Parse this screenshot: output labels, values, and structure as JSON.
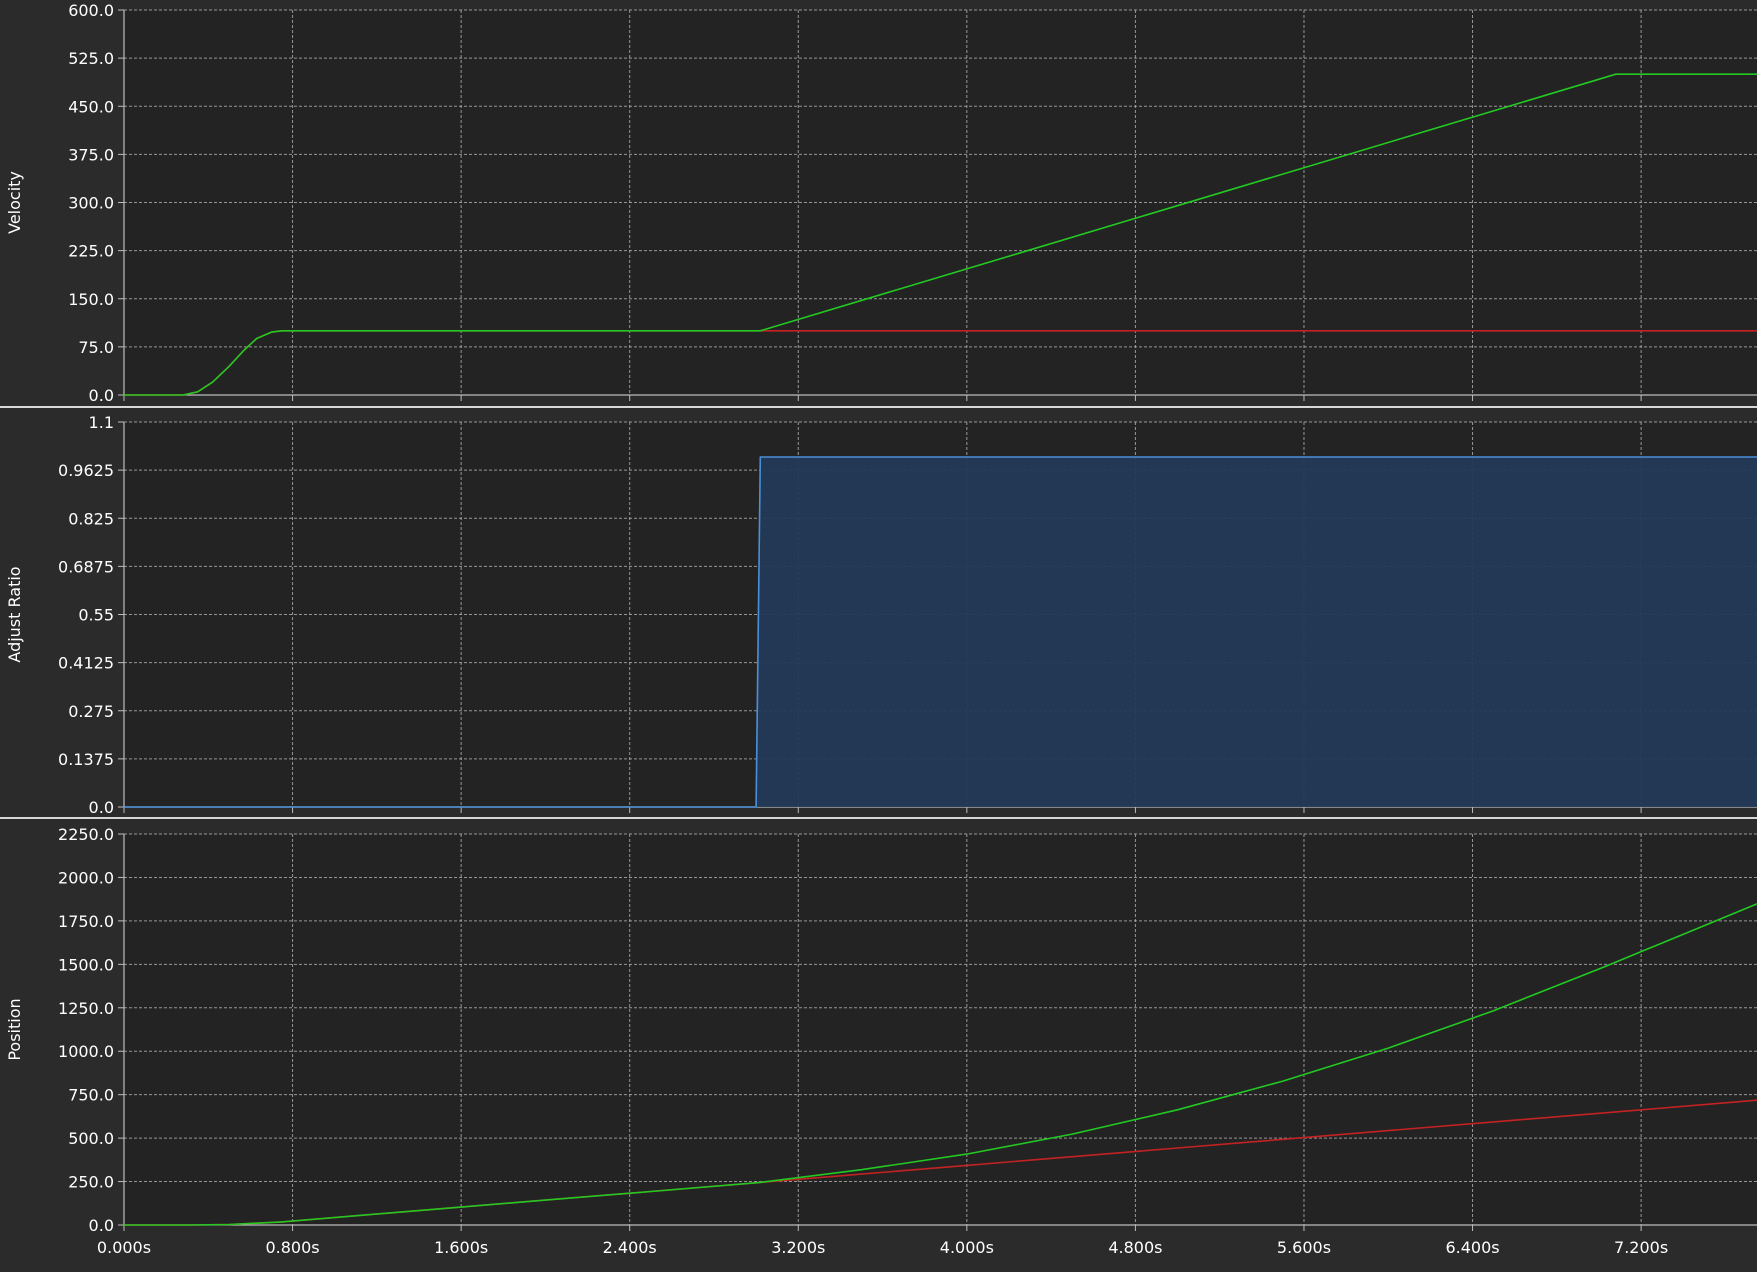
{
  "colors": {
    "background": "#2b2b2b",
    "plot_background": "#232323",
    "grid": "#bdbdbd",
    "text": "#ffffff",
    "separator": "#d8d8d8",
    "green": "#22c922",
    "red": "#c42222",
    "blue": "#4a90d9",
    "blue_fill": "#243a57"
  },
  "chart_data": [
    {
      "type": "line",
      "ylabel": "Velocity",
      "xlim": [
        0,
        7.75
      ],
      "ylim": [
        0,
        600
      ],
      "yticks": [
        "0.0",
        "75.0",
        "150.0",
        "225.0",
        "300.0",
        "375.0",
        "450.0",
        "525.0",
        "600.0"
      ],
      "xticks": [
        "0.000s",
        "0.800s",
        "1.600s",
        "2.400s",
        "3.200s",
        "4.000s",
        "4.800s",
        "5.600s",
        "6.400s",
        "7.200s"
      ],
      "show_xtick_labels": false,
      "grid": true,
      "series": [
        {
          "color_key": "red",
          "points": [
            [
              0,
              0
            ],
            [
              0.2,
              0
            ],
            [
              0.28,
              0
            ],
            [
              0.35,
              5
            ],
            [
              0.42,
              20
            ],
            [
              0.5,
              45
            ],
            [
              0.57,
              70
            ],
            [
              0.63,
              88
            ],
            [
              0.7,
              98
            ],
            [
              0.75,
              100
            ],
            [
              7.75,
              100
            ]
          ]
        },
        {
          "color_key": "green",
          "points": [
            [
              0,
              0
            ],
            [
              0.2,
              0
            ],
            [
              0.28,
              0
            ],
            [
              0.35,
              5
            ],
            [
              0.42,
              20
            ],
            [
              0.5,
              45
            ],
            [
              0.57,
              70
            ],
            [
              0.63,
              88
            ],
            [
              0.7,
              98
            ],
            [
              0.75,
              100
            ],
            [
              3.02,
              100
            ],
            [
              7.08,
              500
            ],
            [
              7.75,
              500
            ]
          ]
        }
      ]
    },
    {
      "type": "area",
      "ylabel": "Adjust Ratio",
      "xlim": [
        0,
        7.75
      ],
      "ylim": [
        0,
        1.1
      ],
      "yticks": [
        "0.0",
        "0.1375",
        "0.275",
        "0.4125",
        "0.55",
        "0.6875",
        "0.825",
        "0.9625",
        "1.1"
      ],
      "xticks": [
        "0.000s",
        "0.800s",
        "1.600s",
        "2.400s",
        "3.200s",
        "4.000s",
        "4.800s",
        "5.600s",
        "6.400s",
        "7.200s"
      ],
      "show_xtick_labels": false,
      "grid": true,
      "series": [
        {
          "color_key": "blue",
          "fill": true,
          "points": [
            [
              0,
              0
            ],
            [
              3.0,
              0
            ],
            [
              3.02,
              1.0
            ],
            [
              7.75,
              1.0
            ]
          ]
        }
      ]
    },
    {
      "type": "line",
      "ylabel": "Position",
      "xlim": [
        0,
        7.75
      ],
      "ylim": [
        0,
        2250
      ],
      "yticks": [
        "0.0",
        "250.0",
        "500.0",
        "750.0",
        "1000.0",
        "1250.0",
        "1500.0",
        "1750.0",
        "2000.0",
        "2250.0"
      ],
      "xticks": [
        "0.000s",
        "0.800s",
        "1.600s",
        "2.400s",
        "3.200s",
        "4.000s",
        "4.800s",
        "5.600s",
        "6.400s",
        "7.200s"
      ],
      "show_xtick_labels": true,
      "grid": true,
      "series": [
        {
          "color_key": "red",
          "points": [
            [
              0,
              0
            ],
            [
              0.3,
              0
            ],
            [
              0.5,
              3
            ],
            [
              0.75,
              18
            ],
            [
              1.5,
              93
            ],
            [
              2.0,
              143
            ],
            [
              2.5,
              193
            ],
            [
              3.0,
              243
            ],
            [
              3.5,
              293
            ],
            [
              4.0,
              343
            ],
            [
              4.5,
              393
            ],
            [
              5.0,
              443
            ],
            [
              5.5,
              493
            ],
            [
              6.0,
              543
            ],
            [
              6.5,
              593
            ],
            [
              7.0,
              643
            ],
            [
              7.5,
              693
            ],
            [
              7.75,
              718
            ]
          ]
        },
        {
          "color_key": "green",
          "points": [
            [
              0,
              0
            ],
            [
              0.3,
              0
            ],
            [
              0.5,
              3
            ],
            [
              0.75,
              18
            ],
            [
              1.5,
              93
            ],
            [
              2.0,
              143
            ],
            [
              2.5,
              193
            ],
            [
              3.02,
              245
            ],
            [
              3.5,
              318
            ],
            [
              4.0,
              408
            ],
            [
              4.5,
              523
            ],
            [
              5.0,
              663
            ],
            [
              5.5,
              828
            ],
            [
              6.0,
              1018
            ],
            [
              6.5,
              1233
            ],
            [
              7.0,
              1473
            ],
            [
              7.08,
              1513
            ],
            [
              7.5,
              1723
            ],
            [
              7.75,
              1848
            ]
          ]
        }
      ]
    }
  ]
}
